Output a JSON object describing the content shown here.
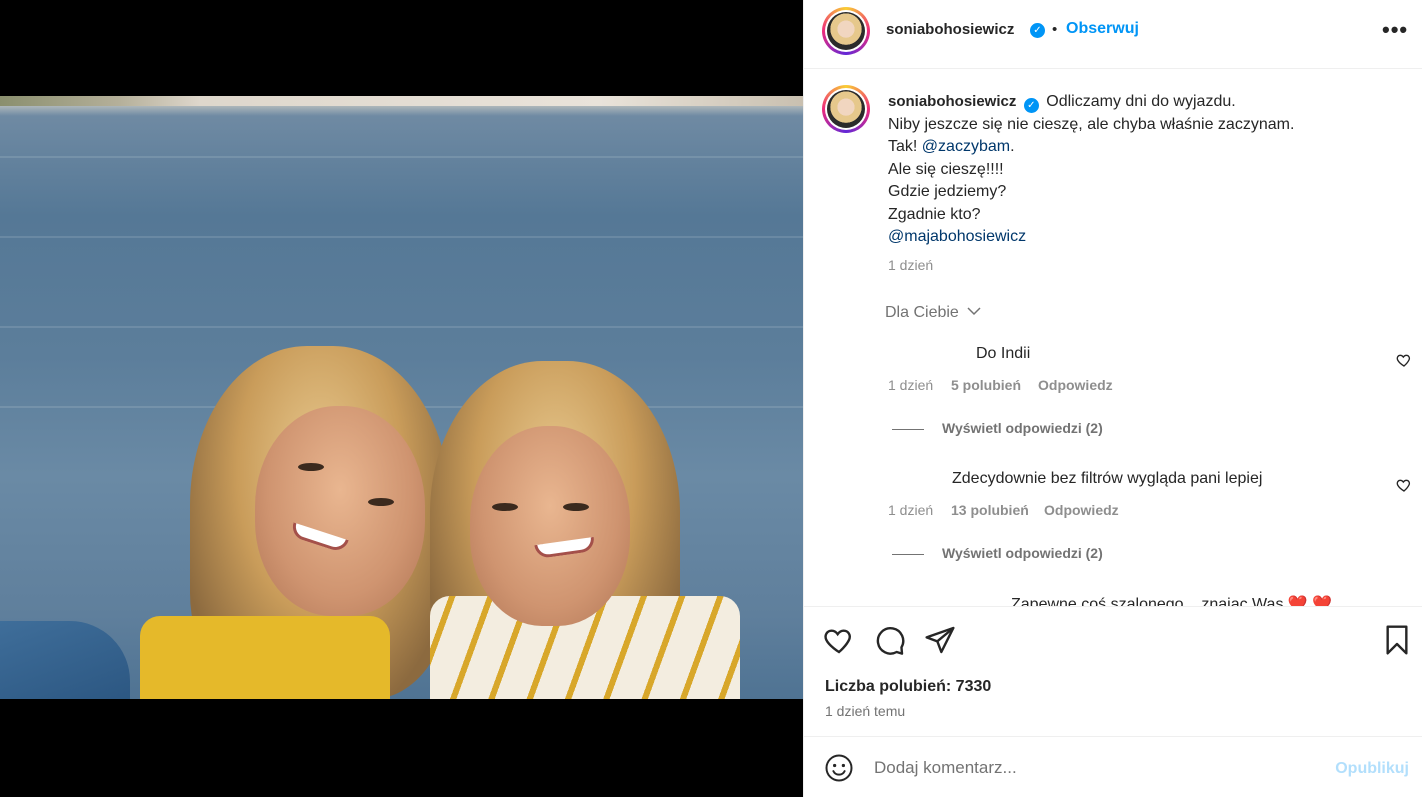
{
  "post": {
    "username": "soniabohosiewicz",
    "verified_mark": "✓",
    "separator": "•",
    "follow_label": "Obserwuj",
    "more_label": "•••"
  },
  "caption": {
    "username": "soniabohosiewicz",
    "line1": "Odliczamy dni do wyjazdu.",
    "line2": "Niby jeszcze się nie cieszę, ale chyba właśnie zaczynam.",
    "line3_prefix": "Tak! ",
    "line3_mention": "@zaczybam",
    "line3_suffix": ".",
    "line4": "Ale się cieszę!!!!",
    "line5": "Gdzie jedziemy?",
    "line6": "Zgadnie kto?",
    "line7_mention": "@majabohosiewicz",
    "time": "1 dzień"
  },
  "sort_label": "Dla Ciebie",
  "comments": [
    {
      "text": "Do Indii",
      "time": "1 dzień",
      "likes": "5 polubień",
      "reply": "Odpowiedz",
      "view_replies": "Wyświetl odpowiedzi (2)"
    },
    {
      "text": "Zdecydownie bez filtrów wygląda pani lepiej",
      "time": "1 dzień",
      "likes": "13 polubień",
      "reply": "Odpowiedz",
      "view_replies": "Wyświetl odpowiedzi (2)"
    },
    {
      "text": "Zapewne coś szalonego... znając Was ❤️ ❤️"
    }
  ],
  "actions": {
    "like_count_label": "Liczba polubień: 7330",
    "time_ago": "1 dzień temu"
  },
  "comment_box": {
    "placeholder": "Dodaj komentarz...",
    "post_label": "Opublikuj"
  },
  "icons": {
    "like": "heart-icon",
    "comment": "comment-icon",
    "share": "send-icon",
    "save": "bookmark-icon",
    "emoji": "emoji-icon",
    "more": "more-icon"
  },
  "colors": {
    "accent": "#0095f6",
    "link": "#00376b",
    "muted": "#8e8e8e"
  }
}
